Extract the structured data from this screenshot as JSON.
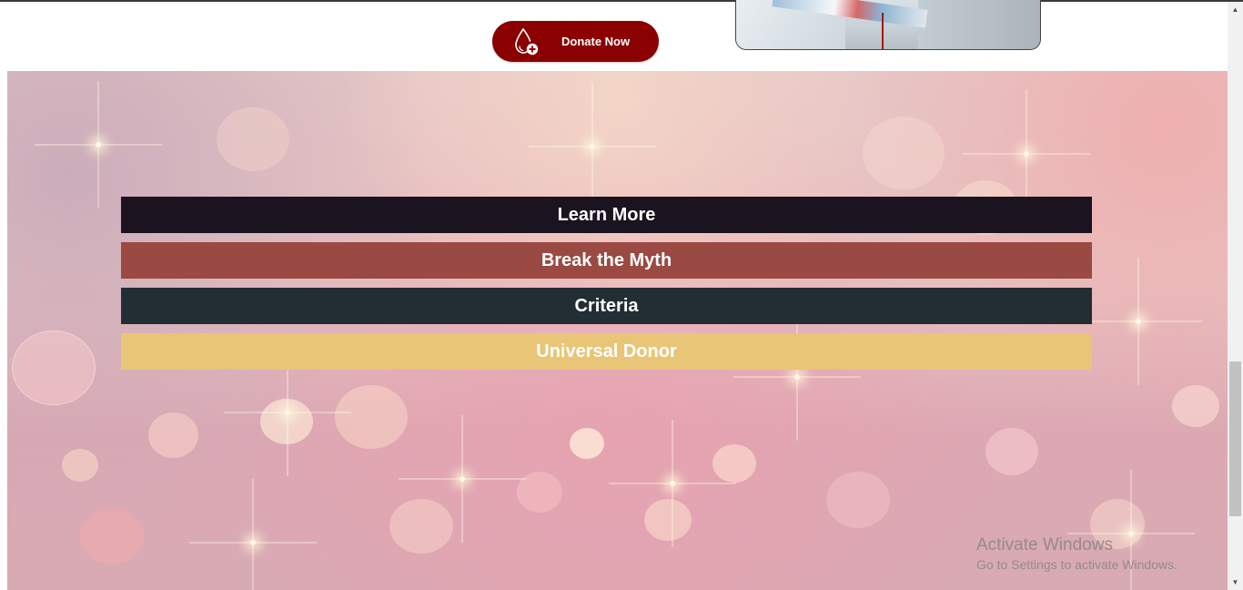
{
  "top": {
    "donate_label": "Donate Now",
    "donate_icon": "blood-drop-plus-icon",
    "donate_color": "#8b0000"
  },
  "menu": {
    "items": [
      {
        "label": "Learn More",
        "color": "#1b1320"
      },
      {
        "label": "Break the Myth",
        "color": "#9a4a42"
      },
      {
        "label": "Criteria",
        "color": "#222e33"
      },
      {
        "label": "Universal Donor",
        "color": "#e9c577"
      }
    ]
  },
  "watermark": {
    "line1": "Activate Windows",
    "line2": "Go to Settings to activate Windows."
  },
  "scrollbar": {
    "up_icon": "scroll-up-arrow-icon",
    "down_icon": "scroll-down-arrow-icon"
  }
}
